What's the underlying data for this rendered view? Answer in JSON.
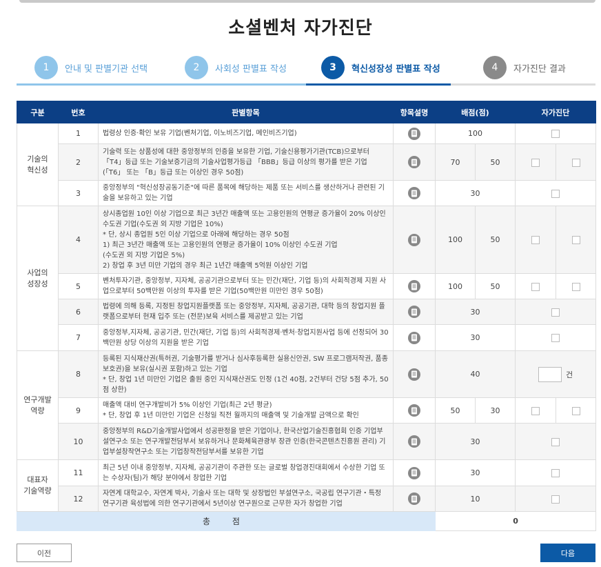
{
  "page": {
    "title": "소셜벤처 자가진단"
  },
  "steps": [
    {
      "num": "1",
      "label": "안내 및 판별기관 선택",
      "state": "done"
    },
    {
      "num": "2",
      "label": "사회성 판별표 작성",
      "state": "done"
    },
    {
      "num": "3",
      "label": "혁신성장성 판별표 작성",
      "state": "active"
    },
    {
      "num": "4",
      "label": "자가진단 결과",
      "state": "todo"
    }
  ],
  "table": {
    "headers": {
      "category": "구분",
      "number": "번호",
      "item": "판별항목",
      "desc": "항목설명",
      "score": "배점(점)",
      "self": "자가진단"
    },
    "categories": {
      "tech": "기술의\n혁신성",
      "growth": "사업의\n성장성",
      "rnd": "연구개발\n역량",
      "ceo": "대표자\n기술역량"
    },
    "rows": [
      {
        "no": "1",
        "text": "법령상 인증·확인 보유 기업(벤처기업, 이노비즈기업, 메인비즈기업)",
        "score": "100"
      },
      {
        "no": "2",
        "text": "기술력 또는 상품성에 대한 중앙정부의 인증을 보유한 기업, 기술신용평가기관(TCB)으로부터 「T4」등급 또는 기술보증기금의 기술사업평가등급 「BBB」등급 이상의 평가를 받은 기업 (「T6」 또는 「B」등급 또는 이상인 경우 50점)",
        "score_a": "70",
        "score_b": "50"
      },
      {
        "no": "3",
        "text": "중앙정부의 \"혁신성장공동기준\"에 따른 품목에 해당하는 제품 또는 서비스를 생산하거나 관련된 기술을 보유하고 있는 기업",
        "score": "30"
      },
      {
        "no": "4",
        "text": "상시종업원 10인 이상 기업으로 최근 3년간 매출액 또는 고용인원의 연평균 증가율이 20% 이상인 수도권 기업(수도권 외 지방 기업은 10%)\n* 단, 상시 종업원 5인 이상 기업으로 아래에 해당하는 경우 50점\n1) 최근 3년간 매출액 또는 고용인원의 연평균 증가율이 10% 이상인 수도권 기업\n    (수도권 외 지방 기업은 5%)\n2) 창업 후 3년 미만 기업의 경우 최근 1년간 매출액 5억원 이상인 기업",
        "score_a": "100",
        "score_b": "50"
      },
      {
        "no": "5",
        "text": "벤처투자기관, 중앙정부, 지자체, 공공기관으로부터 또는 민간(재단, 기업 등)의 사회적경제 지원 사업으로부터 50백만원 이상의 투자를 받은 기업(50백만원 미만인 경우 50점)",
        "score_a": "100",
        "score_b": "50"
      },
      {
        "no": "6",
        "text": "법령에 의해 등록, 지정된 창업지원플랫폼 또는 중앙정부, 지자체, 공공기관, 대학 등의 창업지원 플랫폼으로부터 현재 입주 또는 (전문)보육 서비스를 제공받고 있는 기업",
        "score": "30"
      },
      {
        "no": "7",
        "text": "중앙정부,지자체, 공공기관, 민간(재단, 기업 등)의 사회적경제·벤처·창업지원사업 등에 선정되어 30백만원 상당 이상의 지원을 받은 기업",
        "score": "30"
      },
      {
        "no": "8",
        "text": "등록된 지식재산권(특허권, 기술평가를 받거나 심사후등록한 실용신안권, SW 프로그램저작권, 품종보호권)을 보유(실시권 포함)하고 있는 기업\n* 단, 창업 1년 미만인 기업은 출원 중인 지식재산권도 인정 (1건 40점, 2건부터 건당 5점 추가,  50점 상한)",
        "score": "40",
        "unit": "건"
      },
      {
        "no": "9",
        "text": "매출액 대비 연구개발비가 5% 이상인 기업(최근 2년 평균)\n* 단, 창업 후 1년 미만인 기업은 신청일 직전 월까지의 매출액 및 기술개발 금액으로 확인",
        "score_a": "50",
        "score_b": "30"
      },
      {
        "no": "10",
        "text": "중앙정부의 R&D기술개발사업에서 성공판정을 받은 기업이나, 한국산업기술진흥협회 인증 기업부설연구소 또는 연구개발전담부서 보유하거나 문화체육관광부 장관 인증(한국콘텐츠진흥원 관리) 기업부설창작연구소 또는 기업창작전담부서를 보유한 기업",
        "score": "30"
      },
      {
        "no": "11",
        "text": "최근 5년 이내 중앙정부, 지자체, 공공기관이 주관한 또는 글로벌 창업경진대회에서 수상한 기업 또는 수상자(팀)가 해당 분야에서 창업한 기업",
        "score": "30"
      },
      {
        "no": "12",
        "text": "자연계 대학교수, 자연계 박사, 기술사 또는 대학 및 상장법인 부설연구소, 국공립 연구기관・특정 연구기관 육성법에 의한 연구기관에서 5년이상 연구원으로 근무한 자가 창업한 기업",
        "score": "10"
      }
    ],
    "total_label": "총 점",
    "total_value": "0"
  },
  "buttons": {
    "prev": "이전",
    "next": "다음"
  },
  "colors": {
    "header_bg": "#0c3f85",
    "active_step": "#0c5aa6",
    "done_step": "#8fc5ea",
    "total_bg": "#d8e8f8"
  },
  "icons": {
    "desc": "document-info-icon"
  }
}
